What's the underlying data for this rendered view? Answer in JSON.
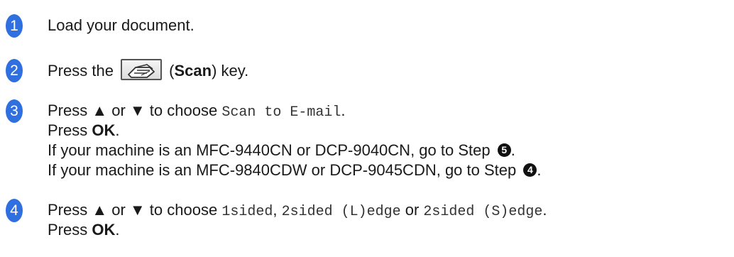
{
  "colors": {
    "badge": "#2f6fe0",
    "text": "#1a1a1a",
    "mono_text": "#333333"
  },
  "steps": [
    {
      "number": "1",
      "text": "Load your document."
    },
    {
      "number": "2",
      "before_key": "Press the ",
      "key_icon": "scan-key-icon",
      "paren_open": " (",
      "key_name": "Scan",
      "after": ") key."
    },
    {
      "number": "3",
      "line1_prefix": "Press ▲ or ▼ to choose ",
      "line1_option": "Scan to E-mail",
      "line1_suffix": ".",
      "line2_prefix": "Press ",
      "line2_key": "OK",
      "line2_suffix": ".",
      "line3_text": "If your machine is an MFC-9440CN or DCP-9040CN, go to Step ",
      "line3_step": "5",
      "line3_suffix": ".",
      "line4_text": "If your machine is an MFC-9840CDW or DCP-9045CDN, go to Step ",
      "line4_step": "4",
      "line4_suffix": "."
    },
    {
      "number": "4",
      "line1_prefix": "Press ▲ or ▼ to choose ",
      "option1": "1sided",
      "sep1": ", ",
      "option2": "2sided (L)edge",
      "sep2": " or ",
      "option3": "2sided (S)edge",
      "line1_suffix": ".",
      "line2_prefix": "Press ",
      "line2_key": "OK",
      "line2_suffix": "."
    }
  ]
}
